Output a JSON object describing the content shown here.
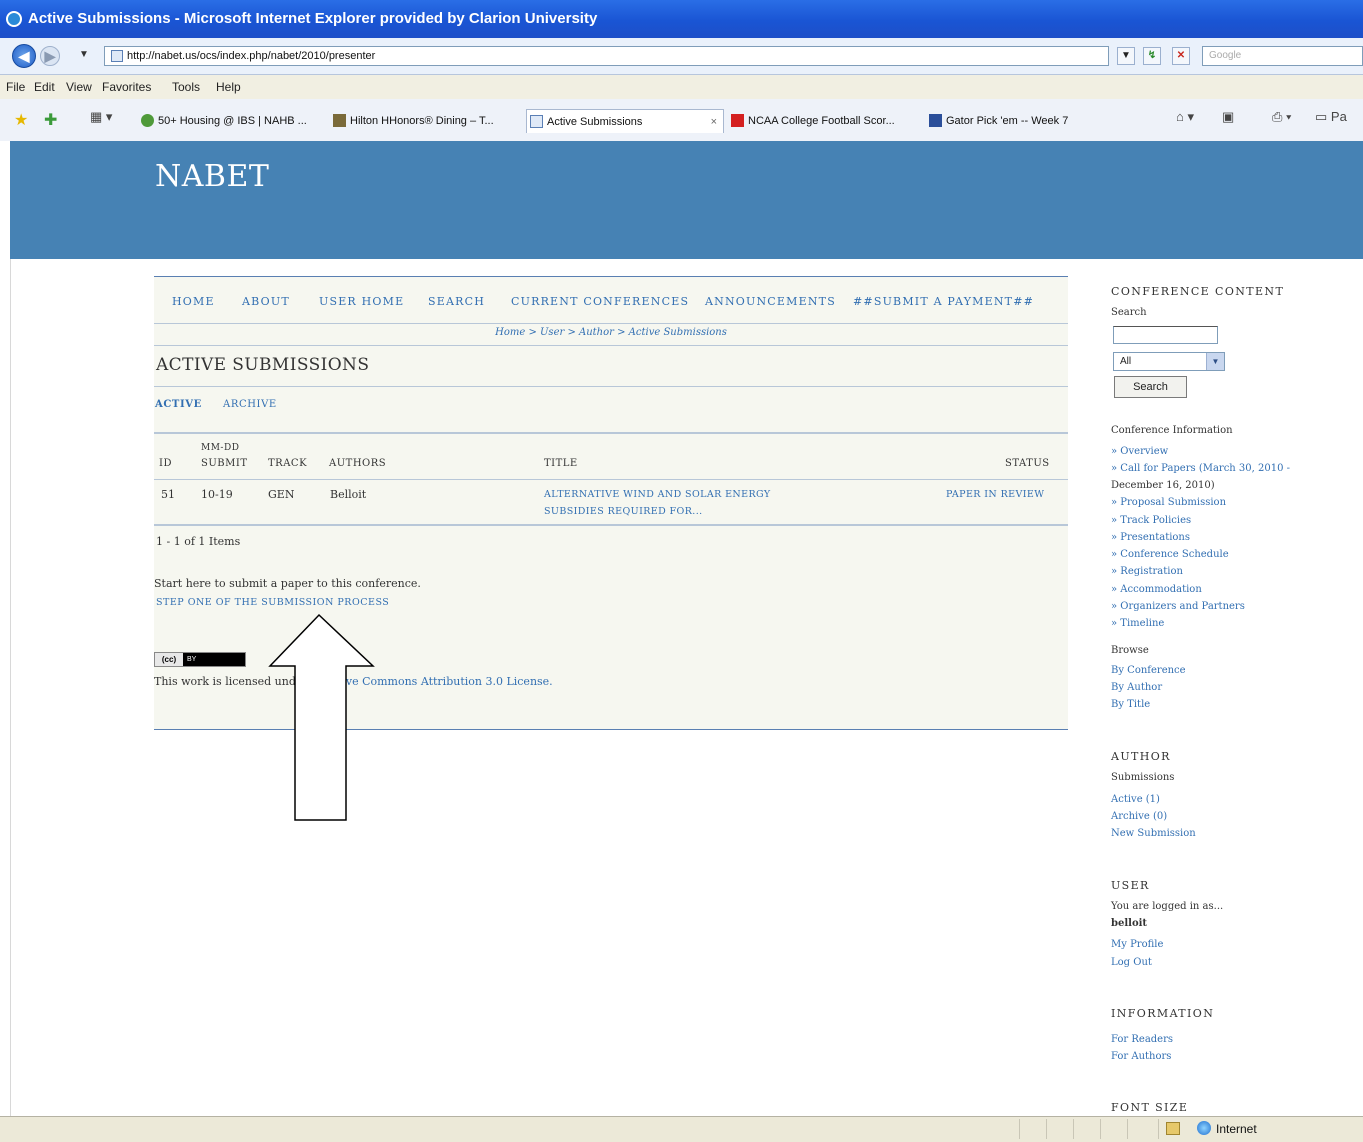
{
  "window": {
    "title": "Active Submissions - Microsoft Internet Explorer provided by Clarion University"
  },
  "address": {
    "url": "http://nabet.us/ocs/index.php/nabet/2010/presenter",
    "search_placeholder": "Google"
  },
  "menubar": [
    "File",
    "Edit",
    "View",
    "Favorites",
    "Tools",
    "Help"
  ],
  "tabs": [
    {
      "label": "50+ Housing @ IBS | NAHB ..."
    },
    {
      "label": "Hilton HHonors® Dining – T..."
    },
    {
      "label": "Active Submissions",
      "close": "×"
    },
    {
      "label": "NCAA College Football Scor..."
    },
    {
      "label": "Gator Pick 'em -- Week 7"
    }
  ],
  "toolbar_right": {
    "page_label": "Pa"
  },
  "site": {
    "title": "NABET"
  },
  "nav": {
    "items": [
      "HOME",
      "ABOUT",
      "USER HOME",
      "SEARCH",
      "CURRENT CONFERENCES",
      "ANNOUNCEMENTS",
      "##SUBMIT A PAYMENT##"
    ]
  },
  "breadcrumb": "Home > User > Author > Active Submissions",
  "page": {
    "title": "ACTIVE SUBMISSIONS",
    "subtabs": [
      "ACTIVE",
      "ARCHIVE"
    ],
    "table": {
      "headers": {
        "id": "ID",
        "date_top": "MM-DD",
        "date": "SUBMIT",
        "track": "TRACK",
        "authors": "AUTHORS",
        "title": "TITLE",
        "status": "STATUS"
      },
      "rows": [
        {
          "id": "51",
          "date": "10-19",
          "track": "GEN",
          "authors": "Belloit",
          "title_line1": "ALTERNATIVE WIND AND SOLAR ENERGY",
          "title_line2": "SUBSIDIES REQUIRED FOR...",
          "status": "PAPER IN REVIEW"
        }
      ],
      "count": "1 - 1 of 1 Items"
    },
    "start_text": "Start here to submit a paper to this conference.",
    "step_link": "STEP ONE OF THE SUBMISSION PROCESS",
    "cc_badge": {
      "left": "(cc)",
      "right": "BY"
    },
    "license_prefix": "This work is licensed under",
    "license_link": "Creative Commons Attribution 3.0 License."
  },
  "sidebar": {
    "conference_content": "CONFERENCE CONTENT",
    "search_label": "Search",
    "select_value": "All",
    "search_button": "Search",
    "conf_info_label": "Conference Information",
    "conf_links": [
      "» Overview",
      "» Call for Papers (March 30, 2010 -",
      "December 16, 2010)",
      "» Proposal Submission",
      "» Track Policies",
      "» Presentations",
      "» Conference Schedule",
      "» Registration",
      "» Accommodation",
      "» Organizers and Partners",
      "» Timeline"
    ],
    "browse_label": "Browse",
    "browse_links": [
      "By Conference",
      "By Author",
      "By Title"
    ],
    "author_heading": "AUTHOR",
    "submissions_label": "Submissions",
    "author_links": [
      "Active (1)",
      "Archive (0)",
      "New Submission"
    ],
    "user_heading": "USER",
    "logged_in_text": "You are logged in as...",
    "username": "belloit",
    "user_links": [
      "My Profile",
      "Log Out"
    ],
    "information_heading": "INFORMATION",
    "info_links": [
      "For Readers",
      "For Authors"
    ],
    "font_size_heading": "FONT SIZE"
  },
  "statusbar": {
    "zone": "Internet"
  }
}
